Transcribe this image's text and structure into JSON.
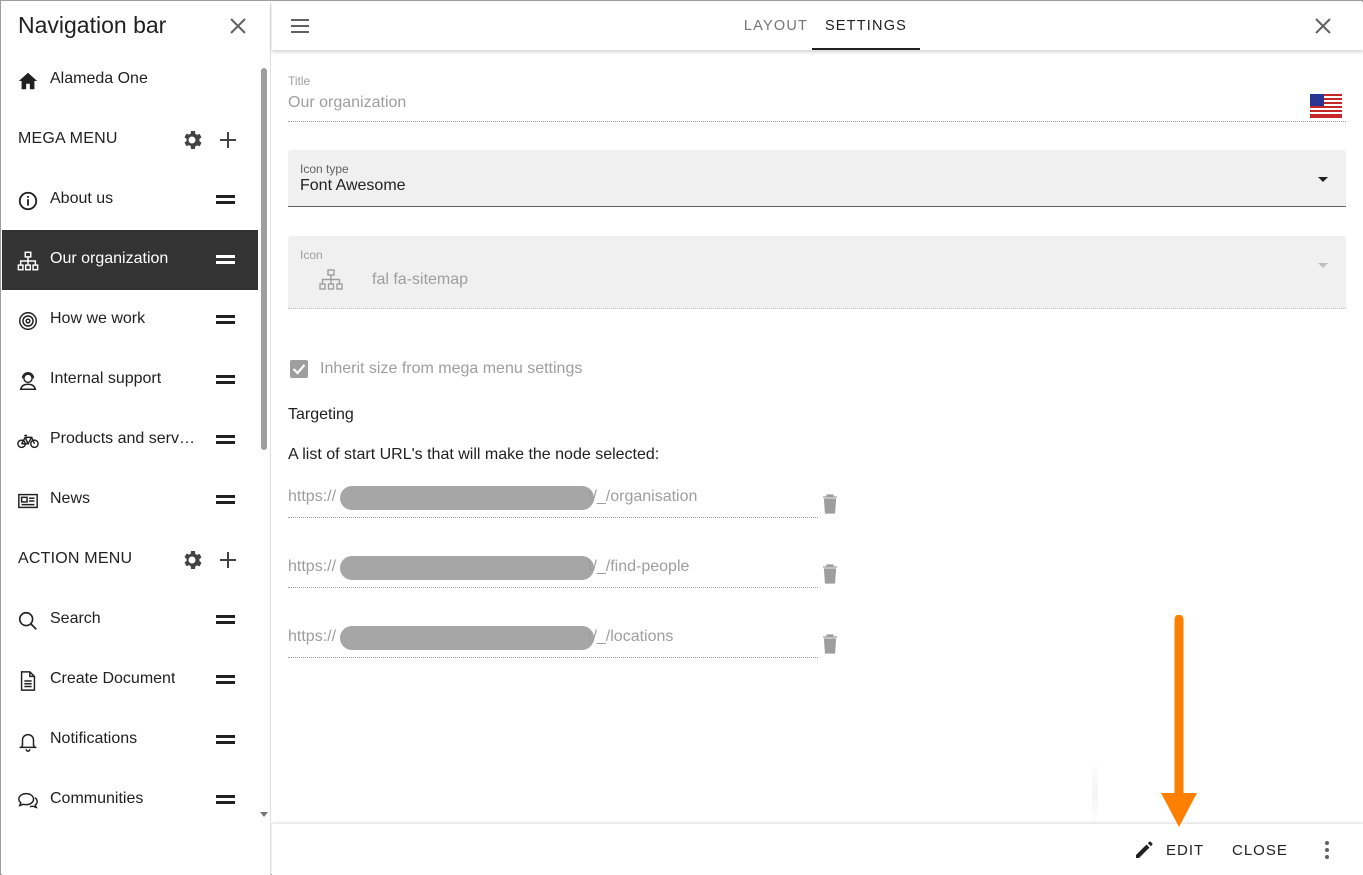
{
  "sidebar": {
    "title": "Navigation bar",
    "home": {
      "label": "Alameda One",
      "icon": "home-icon"
    },
    "mega_menu": {
      "label": "MEGA MENU",
      "items": [
        {
          "label": "About us",
          "icon": "info-circle-icon",
          "active": false
        },
        {
          "label": "Our organization",
          "icon": "sitemap-icon",
          "active": true
        },
        {
          "label": "How we work",
          "icon": "bullseye-icon",
          "active": false
        },
        {
          "label": "Internal support",
          "icon": "user-headset-icon",
          "active": false
        },
        {
          "label": "Products and servi…",
          "icon": "bicycle-icon",
          "active": false
        },
        {
          "label": "News",
          "icon": "newspaper-icon",
          "active": false
        }
      ]
    },
    "action_menu": {
      "label": "ACTION MENU",
      "items": [
        {
          "label": "Search",
          "icon": "search-icon"
        },
        {
          "label": "Create Document",
          "icon": "document-icon"
        },
        {
          "label": "Notifications",
          "icon": "bell-icon"
        },
        {
          "label": "Communities",
          "icon": "comments-icon"
        }
      ]
    }
  },
  "tabs": [
    {
      "label": "LAYOUT",
      "selected": false
    },
    {
      "label": "SETTINGS",
      "selected": true
    }
  ],
  "form": {
    "title": {
      "label": "Title",
      "value": "Our organization",
      "language_flag": "us-flag-icon"
    },
    "icon_type": {
      "label": "Icon type",
      "value": "Font Awesome"
    },
    "icon": {
      "label": "Icon",
      "value": "fal fa-sitemap"
    },
    "inherit_size": {
      "label": "Inherit size from mega menu settings",
      "checked": true
    },
    "targeting": {
      "heading": "Targeting",
      "description": "A list of start URL's that will make the node selected:",
      "urls": [
        {
          "prefix": "https://",
          "suffix": "t/_/organisation"
        },
        {
          "prefix": "https://",
          "suffix": "t/_/find-people"
        },
        {
          "prefix": "https://",
          "suffix": "t/_/locations"
        }
      ]
    }
  },
  "footer": {
    "edit_label": "EDIT",
    "close_label": "CLOSE"
  },
  "colors": {
    "active_item_bg": "#333333",
    "annotation_arrow": "#ff8000",
    "redaction": "#a6a6a6"
  }
}
